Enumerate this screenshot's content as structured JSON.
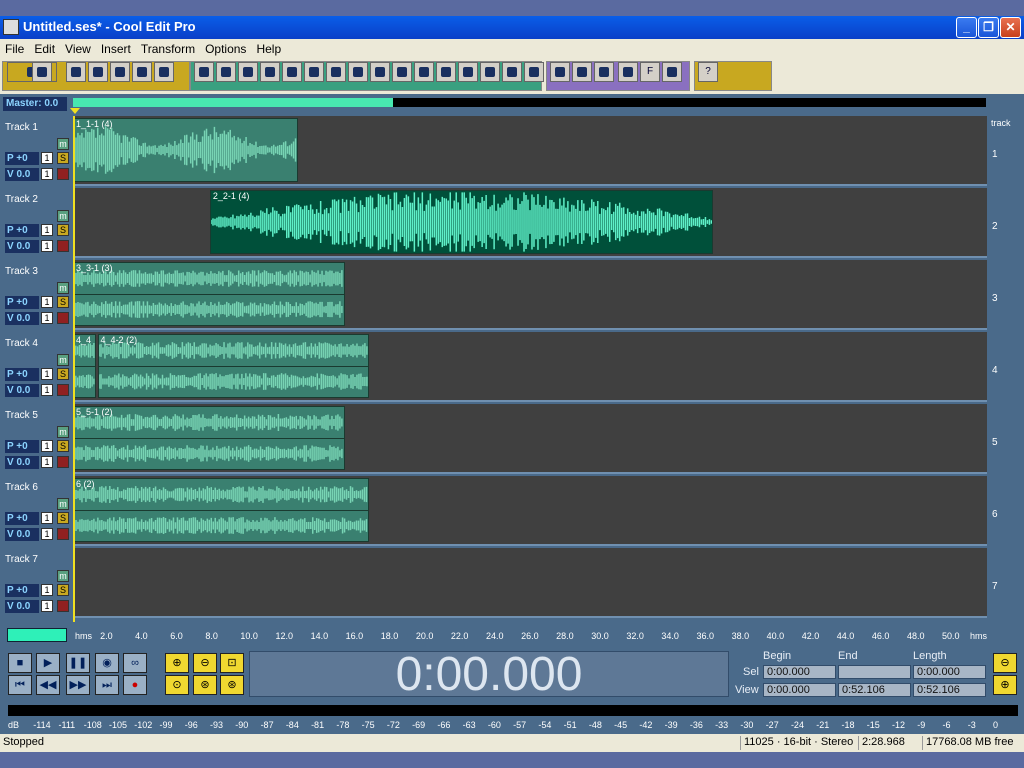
{
  "titlebar": {
    "title": "Untitled.ses* - Cool Edit Pro",
    "minimize": "_",
    "restore": "❐",
    "close": "✕"
  },
  "menu": [
    "File",
    "Edit",
    "View",
    "Insert",
    "Transform",
    "Options",
    "Help"
  ],
  "toolbar": {
    "icons": [
      "waveform-view-icon",
      "new-icon",
      "open-icon",
      "open-append-icon",
      "save-icon",
      "save-as-icon",
      "undo-icon",
      "cut-icon",
      "copy-icon",
      "paste-icon",
      "mix-paste-icon",
      "split-icon",
      "merge-icon",
      "time-stretch-icon",
      "normalize-icon",
      "lock-icon",
      "align-icon",
      "group-icon",
      "insert-icon",
      "eq-icon",
      "envelope-icon",
      "snap-icon",
      "edit-envelope-icon",
      "pan-envelope-icon",
      "volume-icon",
      "zoom-icon",
      "cd-icon",
      "f-icon",
      "loop-icon",
      "help-icon"
    ],
    "f_label": "F",
    "help_label": "?"
  },
  "master": {
    "label": "Master: 0.0"
  },
  "tracks": [
    {
      "name": "Track 1",
      "pan": "P +0",
      "vol": "V 0.0",
      "num": "1",
      "m": "m",
      "s": "S",
      "one": "1",
      "clips": [
        {
          "label": "1_1-1 (4)",
          "stereo": false,
          "start": 0,
          "end": 12.8
        }
      ]
    },
    {
      "name": "Track 2",
      "pan": "P +0",
      "vol": "V 0.0",
      "num": "2",
      "m": "m",
      "s": "S",
      "one": "1",
      "clips": [
        {
          "label": "2_2-1 (4)",
          "stereo": false,
          "start": 7.8,
          "end": 36.5,
          "highlighted": true
        }
      ]
    },
    {
      "name": "Track 3",
      "pan": "P +0",
      "vol": "V 0.0",
      "num": "3",
      "m": "m",
      "s": "S",
      "one": "1",
      "clips": [
        {
          "label": "3_3-1 (3)",
          "stereo": true,
          "start": 0,
          "end": 15.5
        }
      ]
    },
    {
      "name": "Track 4",
      "pan": "P +0",
      "vol": "V 0.0",
      "num": "4",
      "m": "m",
      "s": "S",
      "one": "1",
      "clips": [
        {
          "label": "4_4",
          "stereo": true,
          "start": 0,
          "end": 1.3
        },
        {
          "label": "4_4-2 (2)",
          "stereo": true,
          "start": 1.4,
          "end": 16.9
        }
      ]
    },
    {
      "name": "Track 5",
      "pan": "P +0",
      "vol": "V 0.0",
      "num": "5",
      "m": "m",
      "s": "S",
      "one": "1",
      "clips": [
        {
          "label": "5_5-1 (2)",
          "stereo": true,
          "start": 0,
          "end": 15.5
        }
      ]
    },
    {
      "name": "Track 6",
      "pan": "P +0",
      "vol": "V 0.0",
      "num": "6",
      "m": "m",
      "s": "S",
      "one": "1",
      "clips": [
        {
          "label": "6 (2)",
          "stereo": true,
          "start": 0,
          "end": 16.9
        }
      ]
    },
    {
      "name": "Track 7",
      "pan": "P +0",
      "vol": "V 0.0",
      "num": "7",
      "m": "m",
      "s": "S",
      "one": "1",
      "clips": []
    }
  ],
  "track_col_header": "track",
  "overview": {
    "view_fraction": 0.35
  },
  "ruler": {
    "start_label": "hms",
    "end_label": "hms",
    "ticks": [
      "2.0",
      "4.0",
      "6.0",
      "8.0",
      "10.0",
      "12.0",
      "14.0",
      "16.0",
      "18.0",
      "20.0",
      "22.0",
      "24.0",
      "26.0",
      "28.0",
      "30.0",
      "32.0",
      "34.0",
      "36.0",
      "38.0",
      "40.0",
      "42.0",
      "44.0",
      "46.0",
      "48.0",
      "50.0"
    ],
    "view_seconds": 52.106
  },
  "transport": {
    "time": "0:00.000"
  },
  "selection": {
    "begin_header": "Begin",
    "end_header": "End",
    "length_header": "Length",
    "sel_label": "Sel",
    "view_label": "View",
    "sel_begin": "0:00.000",
    "sel_end": "",
    "sel_length": "0:00.000",
    "view_begin": "0:00.000",
    "view_end": "0:52.106",
    "view_length": "0:52.106"
  },
  "meter": {
    "labels": [
      "dB",
      "-114",
      "-111",
      "-108",
      "-105",
      "-102",
      "-99",
      "-96",
      "-93",
      "-90",
      "-87",
      "-84",
      "-81",
      "-78",
      "-75",
      "-72",
      "-69",
      "-66",
      "-63",
      "-60",
      "-57",
      "-54",
      "-51",
      "-48",
      "-45",
      "-42",
      "-39",
      "-36",
      "-33",
      "-30",
      "-27",
      "-24",
      "-21",
      "-18",
      "-15",
      "-12",
      "-9",
      "-6",
      "-3",
      "0"
    ]
  },
  "status": {
    "state": "Stopped",
    "format": "11025 · 16-bit · Stereo",
    "duration": "2:28.968",
    "free": "17768.08 MB free"
  },
  "colors": {
    "clip": "#3a8070",
    "clip_wave": "#78d4b4",
    "clip_hl": "#00503a",
    "wave_hl": "#5ff0c8",
    "title": "#0a5ee8"
  }
}
